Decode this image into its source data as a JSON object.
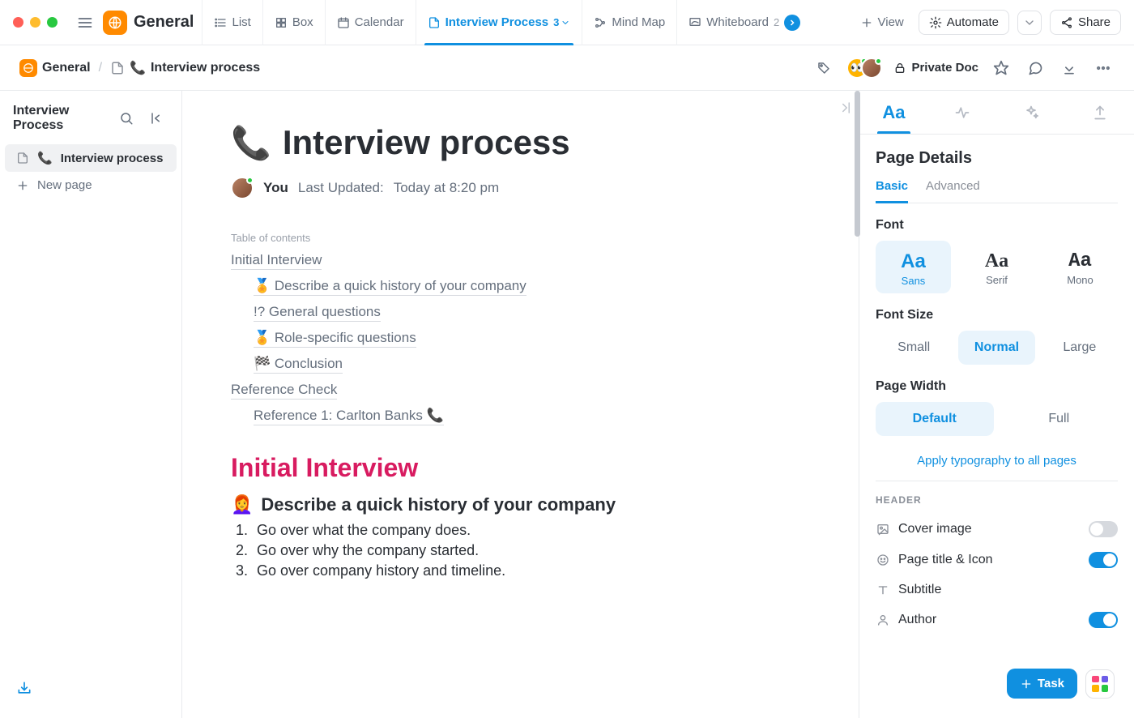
{
  "workspace": {
    "name": "General"
  },
  "tabs": {
    "list": "List",
    "box": "Box",
    "calendar": "Calendar",
    "interview_process": {
      "label": "Interview Process",
      "count": "3"
    },
    "mind_map": "Mind Map",
    "whiteboard": {
      "label": "Whiteboard",
      "count": "2"
    }
  },
  "top_actions": {
    "view": "View",
    "automate": "Automate",
    "share": "Share"
  },
  "breadcrumb": {
    "root": "General",
    "page": "Interview process"
  },
  "doc_access": "Private Doc",
  "sidebar": {
    "title": "Interview Process",
    "items": [
      {
        "label": "Interview process"
      }
    ],
    "new_page": "New page"
  },
  "document": {
    "title": "Interview process",
    "author_label": "You",
    "last_updated_label": "Last Updated:",
    "last_updated_value": "Today at 8:20 pm",
    "toc_label": "Table of contents",
    "toc": {
      "initial_interview": "Initial Interview",
      "history": "🏅 Describe a quick history of your company",
      "general": "!? General questions",
      "role": "🏅 Role-specific questions",
      "conclusion": "🏁 Conclusion",
      "reference_check": "Reference Check",
      "reference1": "Reference 1: Carlton Banks 📞"
    },
    "h1": "Initial Interview",
    "subheading": "Describe a quick history of your company",
    "subheading_emoji": "👩‍🦰",
    "list": [
      "Go over what the company does.",
      "Go over why the company started.",
      "Go over company history and timeline."
    ]
  },
  "right_panel": {
    "title": "Page Details",
    "subtabs": {
      "basic": "Basic",
      "advanced": "Advanced"
    },
    "font_label": "Font",
    "fonts": {
      "sans": "Sans",
      "serif": "Serif",
      "mono": "Mono",
      "glyph": "Aa"
    },
    "font_size_label": "Font Size",
    "font_sizes": {
      "small": "Small",
      "normal": "Normal",
      "large": "Large"
    },
    "page_width_label": "Page Width",
    "page_widths": {
      "default": "Default",
      "full": "Full"
    },
    "apply_all": "Apply typography to all pages",
    "header_section": "HEADER",
    "rows": {
      "cover": "Cover image",
      "title_icon": "Page title & Icon",
      "subtitle": "Subtitle",
      "author": "Author"
    }
  },
  "floating": {
    "task": "Task"
  }
}
